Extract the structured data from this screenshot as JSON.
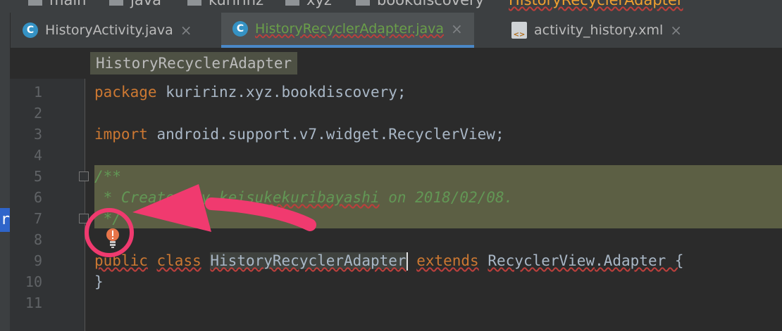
{
  "breadcrumb": {
    "items": [
      "main",
      "java",
      "kuririnz",
      "xyz",
      "bookdiscovery"
    ],
    "current": "HistoryRecyclerAdapter"
  },
  "tabs": [
    {
      "icon": "C",
      "label": "HistoryActivity.java",
      "close": "×"
    },
    {
      "icon": "C",
      "label": "HistoryRecyclerAdapter.java",
      "close": "×"
    },
    {
      "icon": "<>",
      "label": "activity_history.xml",
      "close": "×"
    }
  ],
  "editor": {
    "class_breadcrumb": "HistoryRecyclerAdapter",
    "line_numbers": [
      "1",
      "2",
      "3",
      "4",
      "5",
      "6",
      "7",
      "8",
      "9",
      "10",
      "11"
    ],
    "lines": {
      "l1_kw": "package",
      "l1_rest": " kuririnz.xyz.bookdiscovery;",
      "l3_kw": "import",
      "l3_rest": " android.support.v7.widget.RecyclerView;",
      "l5": "/**",
      "l6_a": " * Created by ",
      "l6_b": "keisukekuribayashi",
      "l6_c": " on 2018/02/08.",
      "l7": " */",
      "l9_kw1": "public",
      "l9_kw2": "class",
      "l9_cls": "HistoryRecyclerAdapter",
      "l9_kw3": "extends",
      "l9_base": "RecyclerView",
      "l9_rest": ".Adapter {",
      "l10": "}"
    }
  },
  "side_label": "r",
  "colors": {
    "annotation": "#f03a6f",
    "keyword": "#cc7832",
    "comment": "#629755"
  }
}
